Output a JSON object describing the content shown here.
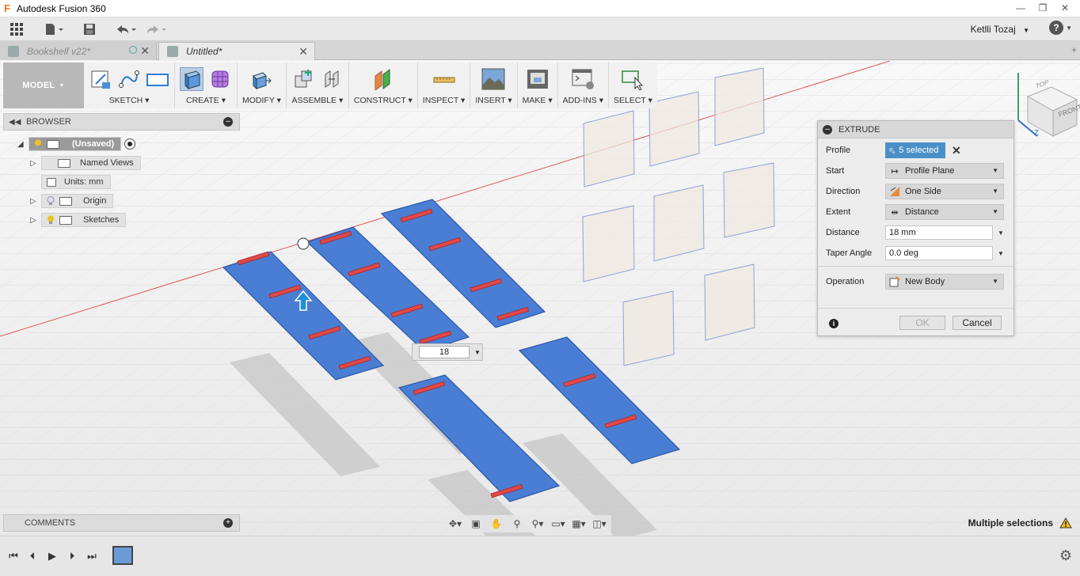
{
  "window": {
    "title": "Autodesk Fusion 360",
    "controls": [
      "minimize",
      "maximize",
      "close"
    ]
  },
  "quick_access": {
    "user": "Ketlli Tozaj",
    "help_symbol": "?"
  },
  "tabs": [
    {
      "label": "Bookshelf v22*",
      "active": false
    },
    {
      "label": "Untitled*",
      "active": true
    }
  ],
  "toolbar": {
    "workspace": "MODEL",
    "groups": [
      {
        "label": "SKETCH"
      },
      {
        "label": "CREATE"
      },
      {
        "label": "MODIFY"
      },
      {
        "label": "ASSEMBLE"
      },
      {
        "label": "CONSTRUCT"
      },
      {
        "label": "INSPECT"
      },
      {
        "label": "INSERT"
      },
      {
        "label": "MAKE"
      },
      {
        "label": "ADD-INS"
      },
      {
        "label": "SELECT"
      }
    ]
  },
  "browser": {
    "title": "BROWSER",
    "items": [
      {
        "label": "(Unsaved)"
      },
      {
        "label": "Named Views"
      },
      {
        "label": "Units: mm"
      },
      {
        "label": "Origin"
      },
      {
        "label": "Sketches"
      }
    ]
  },
  "comments": {
    "title": "COMMENTS"
  },
  "extrude": {
    "title": "EXTRUDE",
    "fields": [
      {
        "label": "Profile",
        "value": "5 selected"
      },
      {
        "label": "Start",
        "value": "Profile Plane"
      },
      {
        "label": "Direction",
        "value": "One Side"
      },
      {
        "label": "Extent",
        "value": "Distance"
      },
      {
        "label": "Distance",
        "value": "18 mm"
      },
      {
        "label": "Taper Angle",
        "value": "0.0 deg"
      },
      {
        "label": "Operation",
        "value": "New Body"
      }
    ],
    "ok_label": "OK",
    "cancel_label": "Cancel"
  },
  "viewport": {
    "distance_input": "18",
    "viewcube": {
      "top": "TOP",
      "front": "FRONT",
      "axis_z": "Z"
    }
  },
  "status": {
    "text": "Multiple selections"
  },
  "colors": {
    "body": "#4a7ed4",
    "slot": "#e04848",
    "accent": "#4a90c8"
  }
}
